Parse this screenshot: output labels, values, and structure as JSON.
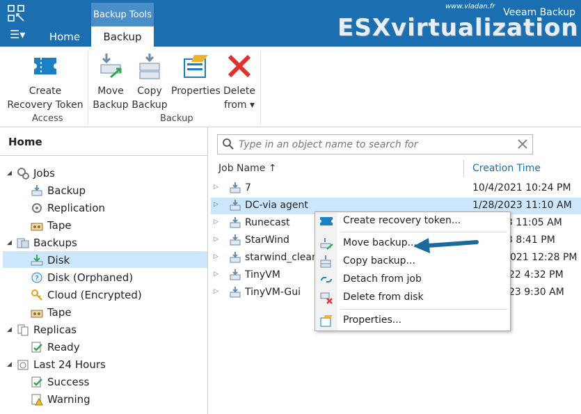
{
  "titlebar": {
    "context_tab_header": "Backup Tools",
    "app_name": "Veeam Backup",
    "watermark_url": "www.vladan.fr",
    "watermark_text": "ESXvirtualization"
  },
  "tabs": [
    {
      "label": "Home"
    },
    {
      "label": "Backup"
    }
  ],
  "ribbon": {
    "buttons": {
      "create_token": {
        "line1": "Create",
        "line2": "Recovery Token"
      },
      "move_backup": {
        "line1": "Move",
        "line2": "Backup"
      },
      "copy_backup": {
        "line1": "Copy",
        "line2": "Backup"
      },
      "properties": {
        "line1": "Properties"
      },
      "delete_from": {
        "line1": "Delete",
        "line2": "from ▾"
      }
    },
    "groups": {
      "access": "Access",
      "backup": "Backup"
    }
  },
  "navigation": {
    "title": "Home",
    "tree": [
      {
        "label": "Jobs"
      },
      {
        "label": "Backup"
      },
      {
        "label": "Replication"
      },
      {
        "label": "Tape"
      },
      {
        "label": "Backups"
      },
      {
        "label": "Disk"
      },
      {
        "label": "Disk (Orphaned)"
      },
      {
        "label": "Cloud (Encrypted)"
      },
      {
        "label": "Tape"
      },
      {
        "label": "Replicas"
      },
      {
        "label": "Ready"
      },
      {
        "label": "Last 24 Hours"
      },
      {
        "label": "Success"
      },
      {
        "label": "Warning"
      }
    ]
  },
  "search": {
    "placeholder": "Type in an object name to search for"
  },
  "columns": {
    "job_name": "Job Name ↑",
    "creation_time": "Creation Time"
  },
  "rows": [
    {
      "name": "7",
      "time": "10/4/2021 10:24 PM"
    },
    {
      "name": "DC-via agent",
      "time": "1/28/2023 11:10 AM"
    },
    {
      "name": "Runecast",
      "time": "3 11:05 AM"
    },
    {
      "name": "StarWind",
      "time": "3 8:41 PM"
    },
    {
      "name": "starwind_clean",
      "time": "021 12:28 PM"
    },
    {
      "name": "TinyVM",
      "time": "22 4:32 PM"
    },
    {
      "name": "TinyVM-Gui",
      "time": "23 9:30 AM"
    }
  ],
  "context_menu": [
    {
      "label": "Create recovery token..."
    },
    {
      "label": "Move backup..."
    },
    {
      "label": "Copy backup..."
    },
    {
      "label": "Detach from job"
    },
    {
      "label": "Delete from disk"
    },
    {
      "label": "Properties..."
    }
  ],
  "colors": {
    "brand_blue": "#1b6eaf",
    "selection": "#cce6fb",
    "callout_arrow": "#1a6a9e"
  }
}
